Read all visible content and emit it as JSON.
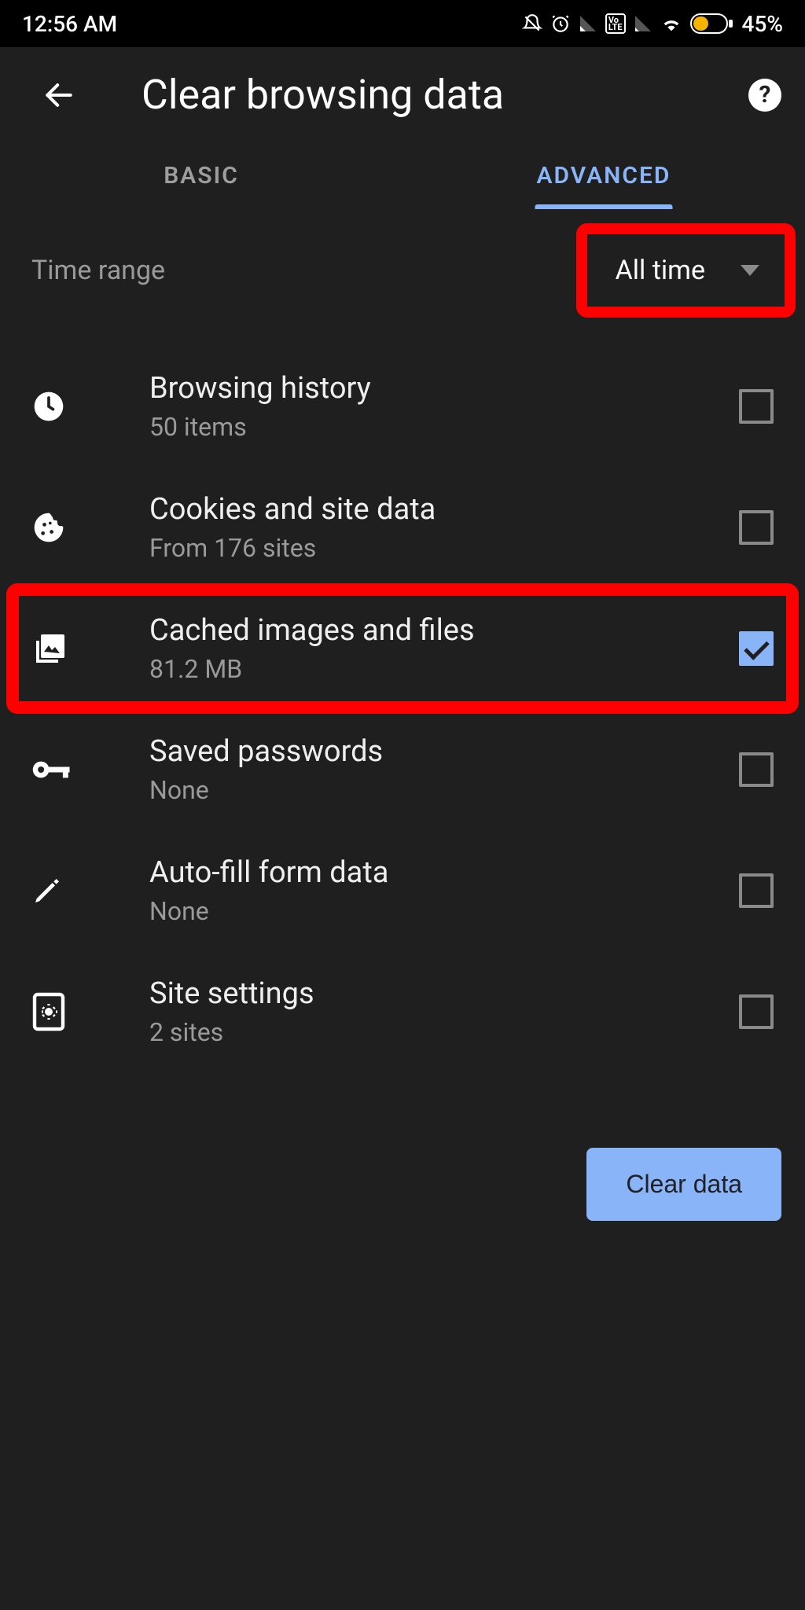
{
  "statusbar": {
    "time": "12:56 AM",
    "battery_pct": "45%"
  },
  "header": {
    "title": "Clear browsing data"
  },
  "tabs": {
    "basic": "BASIC",
    "advanced": "ADVANCED",
    "active": "advanced"
  },
  "time_range": {
    "label": "Time range",
    "selected": "All time"
  },
  "items": [
    {
      "title": "Browsing history",
      "subtitle": "50 items",
      "checked": false,
      "icon": "clock-icon"
    },
    {
      "title": "Cookies and site data",
      "subtitle": "From 176 sites",
      "checked": false,
      "icon": "cookie-icon"
    },
    {
      "title": "Cached images and files",
      "subtitle": "81.2 MB",
      "checked": true,
      "icon": "images-icon",
      "highlighted": true
    },
    {
      "title": "Saved passwords",
      "subtitle": "None",
      "checked": false,
      "icon": "key-icon"
    },
    {
      "title": "Auto-fill form data",
      "subtitle": "None",
      "checked": false,
      "icon": "pencil-icon"
    },
    {
      "title": "Site settings",
      "subtitle": "2 sites",
      "checked": false,
      "icon": "settings-page-icon"
    }
  ],
  "action": {
    "clear_label": "Clear data"
  }
}
